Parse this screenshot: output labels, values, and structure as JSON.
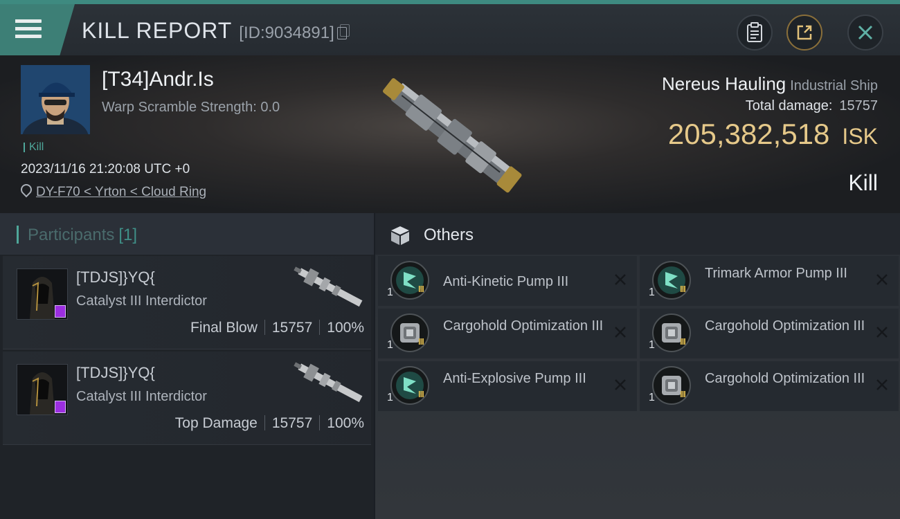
{
  "header": {
    "title": "KILL REPORT",
    "report_id": "[ID:9034891]"
  },
  "victim": {
    "name": "[T34]Andr.Is",
    "warp_scramble": "Warp Scramble Strength: 0.0",
    "tag": "Kill",
    "timestamp": "2023/11/16 21:20:08 UTC +0",
    "location": "DY-F70 < Yrton < Cloud Ring",
    "ship_name": "Nereus Hauling",
    "ship_class": "Industrial Ship",
    "total_damage_label": "Total damage:",
    "total_damage": "15757",
    "isk_value": "205,382,518",
    "isk_unit": "ISK",
    "result": "Kill"
  },
  "participants": {
    "label": "Participants",
    "count": "[1]",
    "rows": [
      {
        "name": "[TDJS]}YQ{",
        "ship": "Catalyst III Interdictor",
        "role": "Final Blow",
        "damage": "15757",
        "percent": "100%"
      },
      {
        "name": "[TDJS]}YQ{",
        "ship": "Catalyst III Interdictor",
        "role": "Top Damage",
        "damage": "15757",
        "percent": "100%"
      }
    ]
  },
  "others": {
    "label": "Others",
    "items": [
      {
        "qty": "1",
        "tier": "III",
        "name": "Anti-Kinetic Pump III",
        "icon": "armor-pump-icon"
      },
      {
        "qty": "1",
        "tier": "III",
        "name": "Trimark Armor Pump III",
        "icon": "armor-pump-icon"
      },
      {
        "qty": "1",
        "tier": "III",
        "name": "Cargohold Optimization III",
        "icon": "cargohold-icon"
      },
      {
        "qty": "1",
        "tier": "III",
        "name": "Cargohold Optimization III",
        "icon": "cargohold-icon"
      },
      {
        "qty": "1",
        "tier": "III",
        "name": "Anti-Explosive Pump III",
        "icon": "armor-pump-icon"
      },
      {
        "qty": "1",
        "tier": "III",
        "name": "Cargohold Optimization III",
        "icon": "cargohold-icon"
      }
    ]
  },
  "colors": {
    "accent": "#3d7f76",
    "isk": "#e6c98a",
    "tier": "#d8b54d"
  }
}
